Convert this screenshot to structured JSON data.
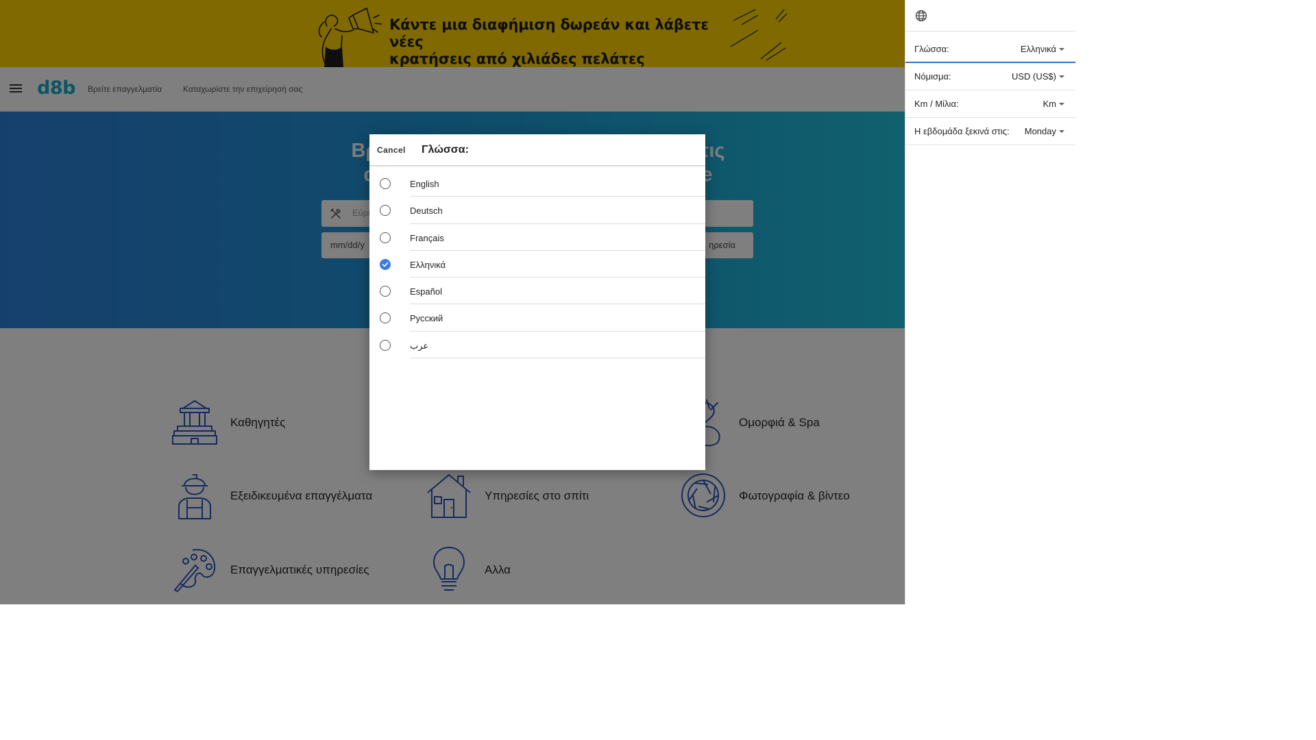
{
  "banner": {
    "text_line1": "Κάντε μια διαφήμιση δωρεάν και λάβετε νέες",
    "text_line2": "κρατήσεις από χιλιάδες πελάτες"
  },
  "topnav": {
    "logo": "d8b",
    "links": [
      "Βρείτε επαγγελματία",
      "Καταχωρίστε την επιχείρησή σας"
    ]
  },
  "hero": {
    "title_start": "Βρ",
    "title_end": "τις",
    "title_line2_start": "α",
    "title_line2_end": "e",
    "search_placeholder": "Εύρη",
    "date_placeholder": "mm/dd/y",
    "service_label": "ηρεσία"
  },
  "categories": [
    {
      "label": "Καθηγητές",
      "icon": "school-building-icon"
    },
    {
      "label": "Ομορφιά & Spa",
      "icon": "beauty-icon"
    },
    {
      "label": "Εξειδικευμένα επαγγέλματα",
      "icon": "worker-icon"
    },
    {
      "label": "Υπηρεσίες στο σπίτι",
      "icon": "house-icon"
    },
    {
      "label": "Φωτογραφία & βίντεο",
      "icon": "camera-aperture-icon"
    },
    {
      "label": "Επαγγελματικές υπηρεσίες",
      "icon": "palette-icon"
    },
    {
      "label": "Αλλα",
      "icon": "lightbulb-icon"
    }
  ],
  "modal": {
    "cancel_label": "Cancel",
    "title": "Γλώσσα:",
    "options": [
      {
        "label": "English",
        "checked": false
      },
      {
        "label": "Deutsch",
        "checked": false
      },
      {
        "label": "Français",
        "checked": false
      },
      {
        "label": "Ελληνικά",
        "checked": true
      },
      {
        "label": "Español",
        "checked": false
      },
      {
        "label": "Русский",
        "checked": false
      },
      {
        "label": "عرب",
        "checked": false
      }
    ]
  },
  "side_panel": {
    "settings": [
      {
        "label": "Γλώσσα:",
        "value": "Ελληνικά"
      },
      {
        "label": "Νόμισμα:",
        "value": "USD (US$)"
      },
      {
        "label": "Km / Μίλια:",
        "value": "Km"
      },
      {
        "label": "Η εβδομάδα ξεκινά στις:",
        "value": "Monday"
      }
    ]
  },
  "colors": {
    "banner": "#FFD200",
    "brand": "#1aa9c9",
    "accent": "#3d7be0",
    "icon_stroke": "#2a55b8"
  }
}
